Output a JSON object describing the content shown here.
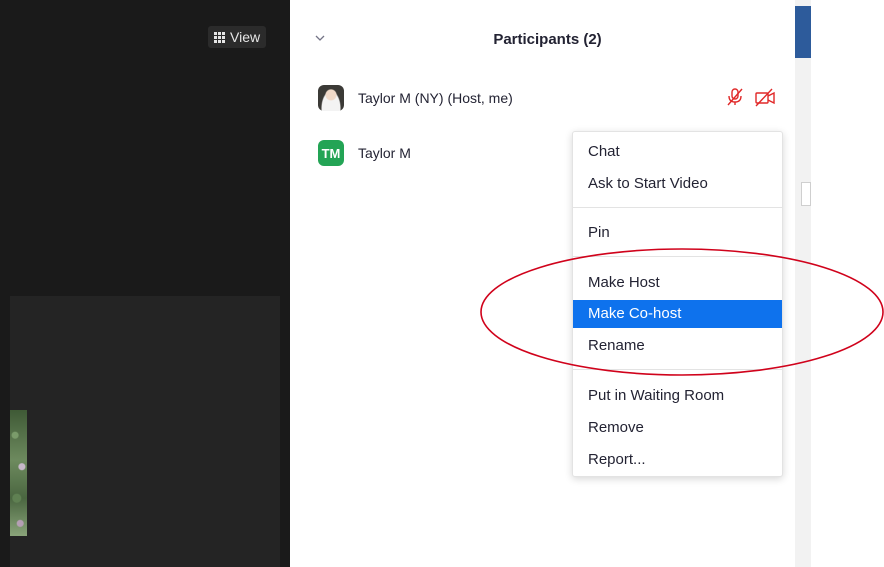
{
  "video": {
    "view_label": "View",
    "view_icon": "grid-icon"
  },
  "participants_panel": {
    "title": "Participants (2)",
    "collapse_icon": "chevron-down-icon",
    "participants": [
      {
        "name": "Taylor M (NY) (Host, me)",
        "avatar": "photo",
        "mic_muted": true,
        "video_off": true
      },
      {
        "name": "Taylor M",
        "avatar_initials": "TM",
        "avatar_color": "#23a455"
      }
    ]
  },
  "context_menu": {
    "items": [
      {
        "label": "Chat"
      },
      {
        "label": "Ask to Start Video"
      },
      {
        "label": "Pin"
      },
      {
        "label": "Make Host"
      },
      {
        "label": "Make Co-host",
        "highlighted": true
      },
      {
        "label": "Rename"
      },
      {
        "label": "Put in Waiting Room"
      },
      {
        "label": "Remove"
      },
      {
        "label": "Report..."
      }
    ]
  },
  "colors": {
    "highlight": "#0e72ed",
    "muted_icon": "#e02828",
    "annotation": "#d0021b"
  }
}
